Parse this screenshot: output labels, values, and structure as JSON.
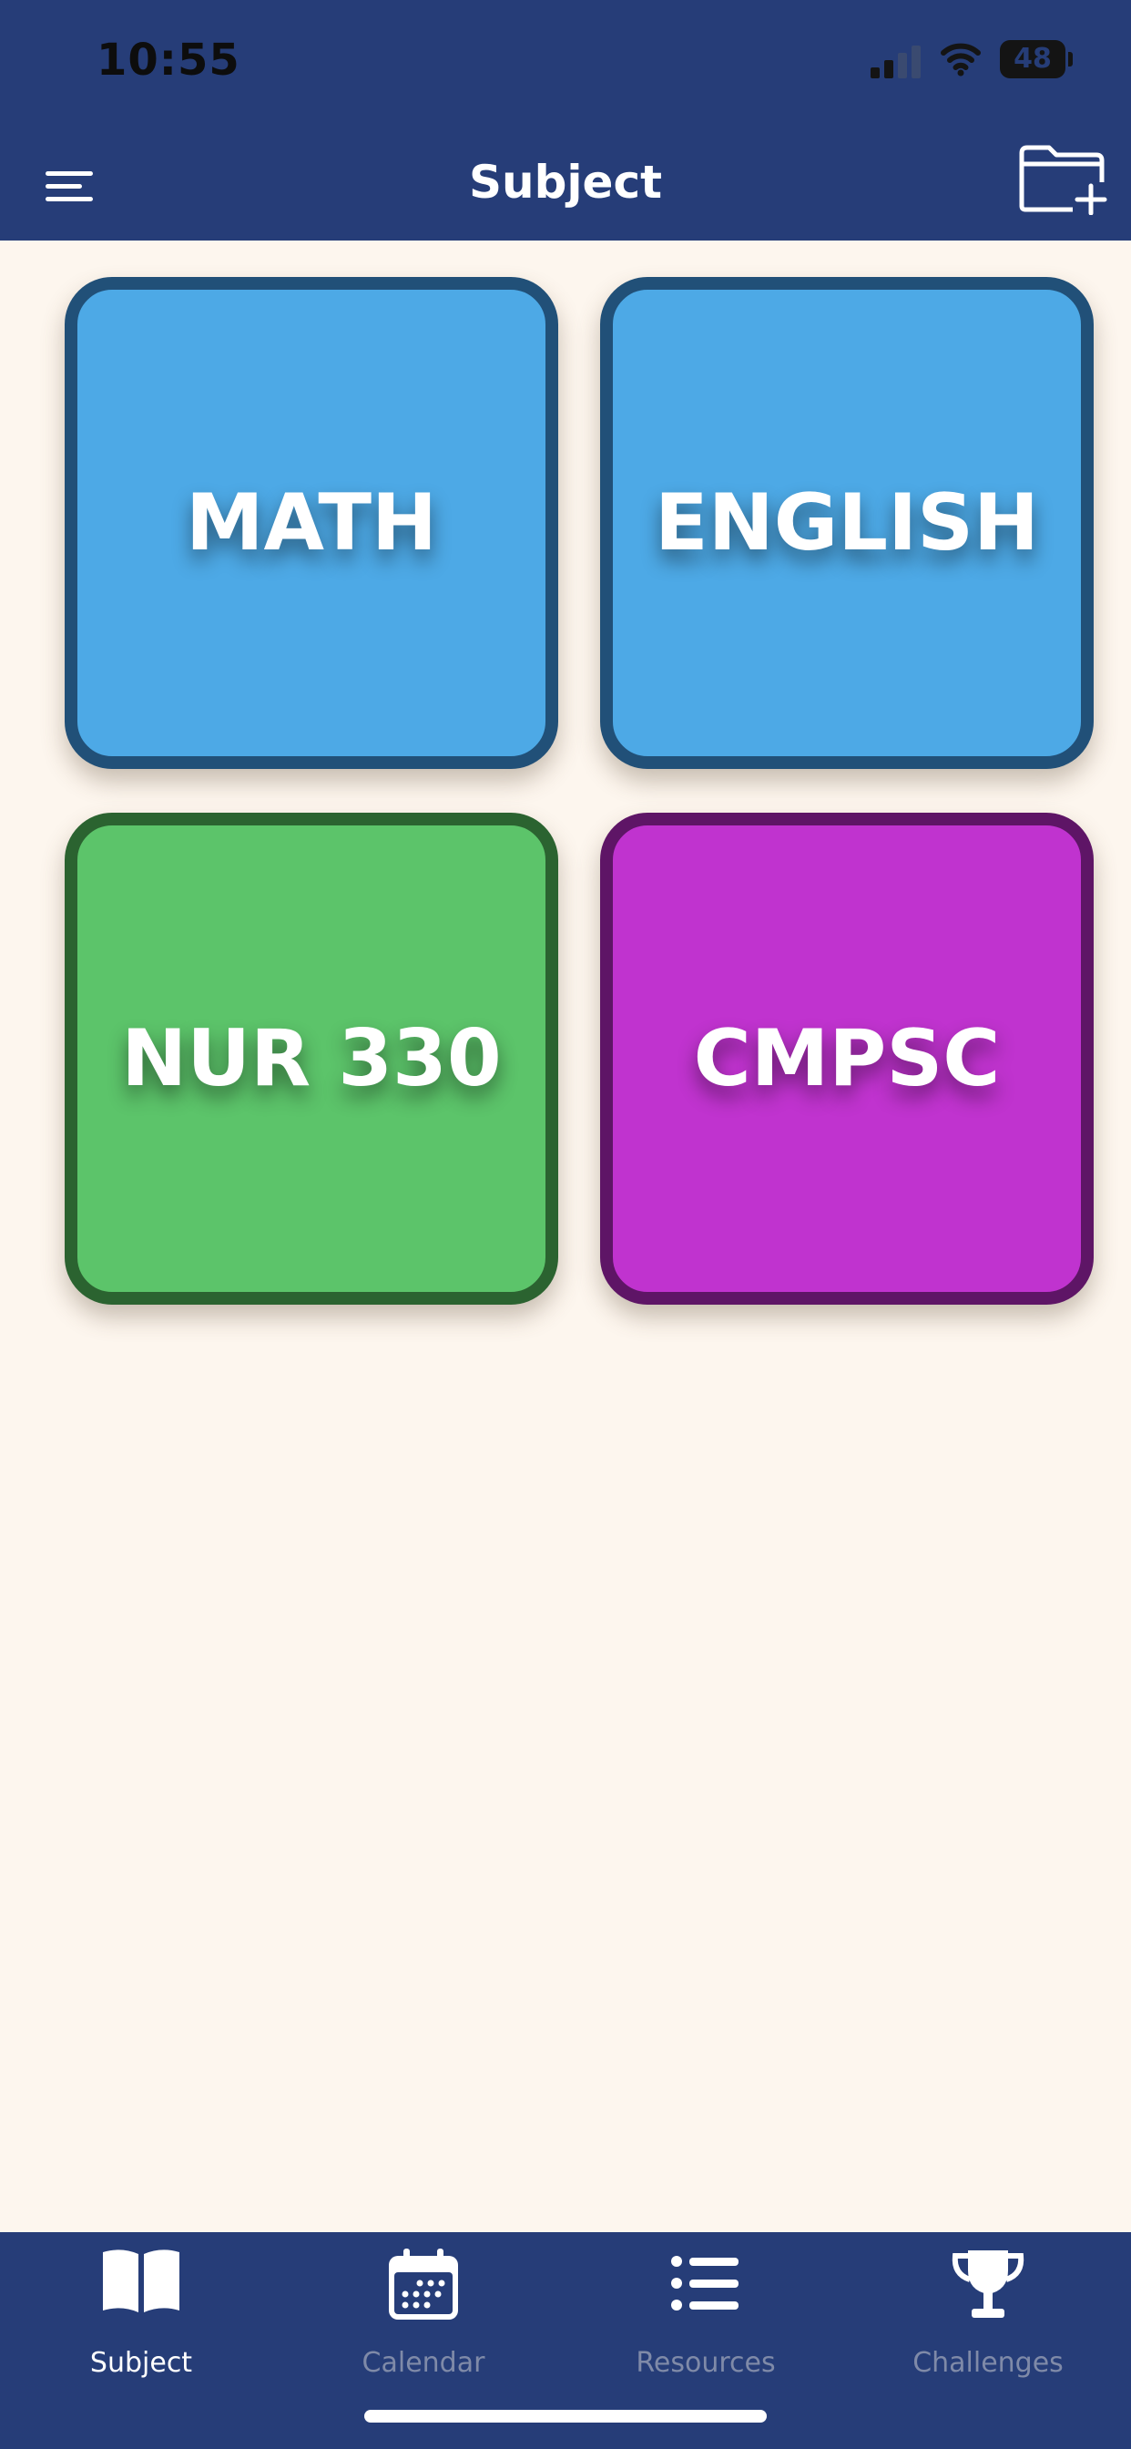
{
  "status_bar": {
    "time": "10:55",
    "battery": "48"
  },
  "header": {
    "title": "Subject"
  },
  "subjects": [
    {
      "label": "MATH",
      "fill": "#4da9e6",
      "border": "#215078"
    },
    {
      "label": "ENGLISH",
      "fill": "#4da9e6",
      "border": "#215078"
    },
    {
      "label": "NUR 330",
      "fill": "#5cc46a",
      "border": "#2b6330"
    },
    {
      "label": "CMPSC",
      "fill": "#c033cf",
      "border": "#5e1566"
    }
  ],
  "tabs": [
    {
      "label": "Subject",
      "icon": "book-icon",
      "active": true
    },
    {
      "label": "Calendar",
      "icon": "calendar-icon",
      "active": false
    },
    {
      "label": "Resources",
      "icon": "list-icon",
      "active": false
    },
    {
      "label": "Challenges",
      "icon": "trophy-icon",
      "active": false
    }
  ],
  "colors": {
    "nav_bar": "#263d78",
    "background": "#fdf6ee",
    "tab_active": "#ffffff",
    "tab_inactive": "#7f8aa8"
  }
}
